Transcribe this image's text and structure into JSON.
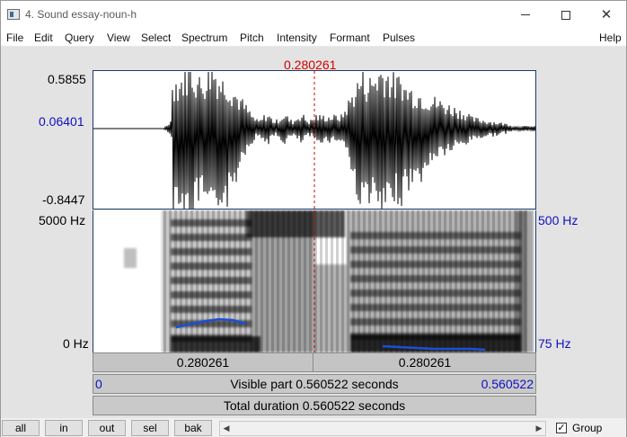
{
  "window": {
    "title": "4. Sound essay-noun-h"
  },
  "menu": [
    "File",
    "Edit",
    "Query",
    "View",
    "Select",
    "Spectrum",
    "Pitch",
    "Intensity",
    "Formant",
    "Pulses",
    "Help"
  ],
  "cursor": {
    "time_label": "0.280261"
  },
  "waveform": {
    "y_max_label": "0.5855",
    "y_zero_label": "0.06401",
    "y_min_label": "-0.8447"
  },
  "spectrogram": {
    "freq_top_label": "5000 Hz",
    "freq_bottom_label": "0 Hz",
    "pitch_top_label": "500 Hz",
    "pitch_bottom_label": "75 Hz"
  },
  "selection": {
    "left_duration": "0.280261",
    "right_duration": "0.280261"
  },
  "visible": {
    "start": "0",
    "label": "Visible part 0.560522 seconds",
    "end": "0.560522"
  },
  "total": {
    "label": "Total duration 0.560522 seconds"
  },
  "buttons": {
    "all": "all",
    "in": "in",
    "out": "out",
    "sel": "sel",
    "bak": "bak"
  },
  "group": {
    "label": "Group",
    "checked": true,
    "check_mark": "✓"
  },
  "colors": {
    "cursor": "#d00000",
    "pitch": "#1a4fd8",
    "axis_blue": "#1010c0"
  }
}
